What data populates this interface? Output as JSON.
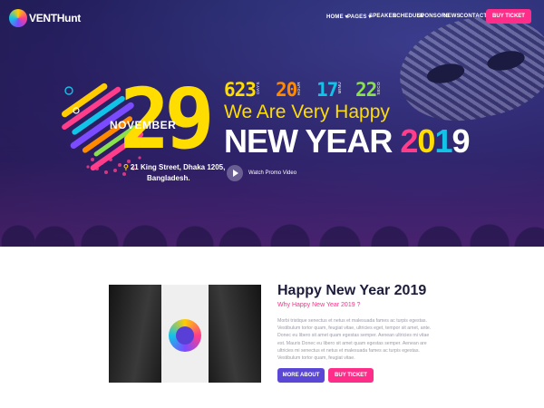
{
  "brand": {
    "logo_text": "VENTHunt"
  },
  "nav": {
    "items": [
      {
        "label": "HOME ▾"
      },
      {
        "label": "PAGES ▾"
      },
      {
        "label": "SPEAKER"
      },
      {
        "label": "SCHEDULE"
      },
      {
        "label": "SPONSORS"
      },
      {
        "label": "NEWS"
      },
      {
        "label": "CONTACT"
      }
    ],
    "cta_label": "BUY TICKET"
  },
  "hero": {
    "date_day": "29",
    "date_month": "NOVEMBER",
    "address_line1": "21 King Street, Dhaka 1205,",
    "address_line2": "Bangladesh.",
    "countdown": [
      {
        "value": "623",
        "unit": "DAYS",
        "color": "#ffdd00"
      },
      {
        "value": "20",
        "unit": "HOUR",
        "color": "#ff8a00"
      },
      {
        "value": "17",
        "unit": "MINU",
        "color": "#12c3e8"
      },
      {
        "value": "22",
        "unit": "SECO",
        "color": "#8be04e"
      }
    ],
    "headline": "We Are Very Happy",
    "new_year_text": "NEW YEAR",
    "year_digits": [
      "2",
      "0",
      "1",
      "9"
    ],
    "promo_label": "Watch Promo Video"
  },
  "about": {
    "title": "Happy New Year 2019",
    "subtitle": "Why Happy New Year 2019 ?",
    "body": "Morbi tristique senectus et netus et malesuada fames ac turpis egestas. Vestibulum tortor quam, feugiat vitae, ultricies eget, tempor sit amet, ante. Donec eu libero sit amet quam egestas semper. Aenean ultricies mi vitae est. Mauris Donec eu libero sit amet quam egestas semper. Aenean are ultricies mi senectus et netus et malesuada fames ac turpis egestas. Vestibulum tortor quam, feugiat vitae.",
    "more_label": "MORE ABOUT",
    "buy_label": "BUY TICKET"
  },
  "colors": {
    "accent_pink": "#ff2d8a",
    "accent_purple": "#5a47d6",
    "accent_yellow": "#ffdd00",
    "hero_bg": "#2c2f74"
  }
}
